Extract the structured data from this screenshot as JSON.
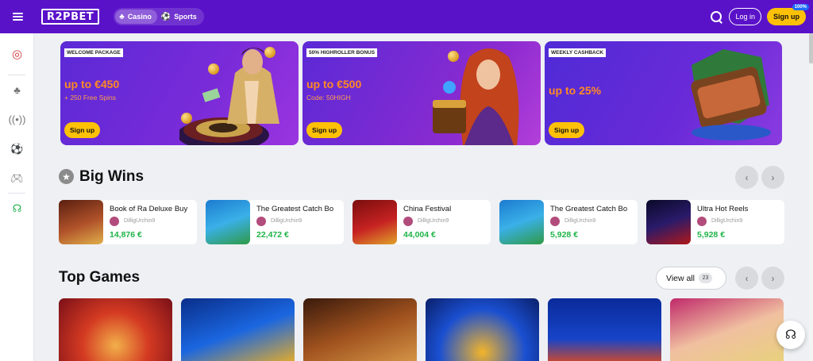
{
  "header": {
    "logo_text": "R2PBET",
    "tabs": [
      {
        "label": "Casino",
        "active": true
      },
      {
        "label": "Sports",
        "active": false
      }
    ],
    "login_label": "Log in",
    "signup_label": "Sign up",
    "signup_badge": "100%"
  },
  "sidebar": {
    "items": [
      "darts-icon",
      "cherries-icon",
      "live-icon",
      "football-icon",
      "gamepad-icon",
      "support-icon"
    ]
  },
  "promos": [
    {
      "tag": "WELCOME PACKAGE",
      "headline": "up to €450",
      "sub": "+ 250 Free Spins",
      "cta": "Sign up"
    },
    {
      "tag": "50% HIGHROLLER BONUS",
      "headline": "up to €500",
      "sub": "Code: 50HIGH",
      "cta": "Sign up"
    },
    {
      "tag": "WEEKLY CASHBACK",
      "headline": "up to 25%",
      "sub": "",
      "cta": "Sign up"
    }
  ],
  "big_wins": {
    "title": "Big Wins",
    "items": [
      {
        "game": "Book of Ra Deluxe Buy",
        "user": "DilligUrchin9",
        "amount": "14,876 €"
      },
      {
        "game": "The Greatest Catch Bo",
        "user": "DilligUrchin9",
        "amount": "22,472 €"
      },
      {
        "game": "China Festival",
        "user": "DilligUrchin9",
        "amount": "44,004 €"
      },
      {
        "game": "The Greatest Catch Bo",
        "user": "DilligUrchin9",
        "amount": "5,928 €"
      },
      {
        "game": "Ultra Hot Reels",
        "user": "DilligUrchin9",
        "amount": "5,928 €"
      }
    ]
  },
  "top_games": {
    "title": "Top Games",
    "view_all_label": "View all",
    "view_all_count": "23"
  },
  "colors": {
    "brand": "#5a12c9",
    "accent": "#ffc107",
    "win_amount": "#1eb447",
    "promo_headline": "#ff8a22"
  }
}
